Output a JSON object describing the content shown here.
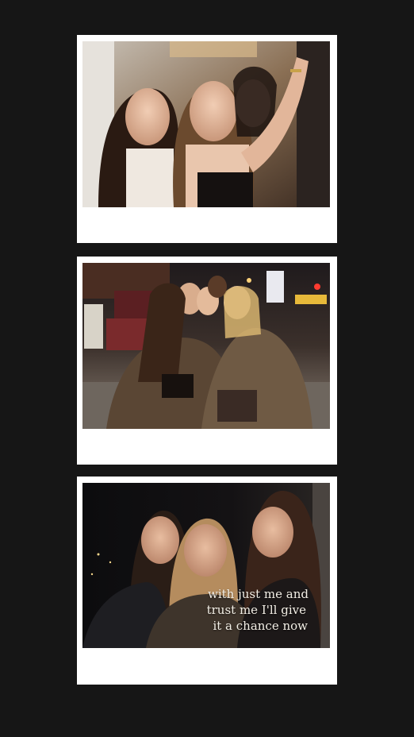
{
  "frames": [
    {
      "name": "photo-selfie-trio"
    },
    {
      "name": "photo-street-hug"
    },
    {
      "name": "photo-night-group"
    }
  ],
  "overlay_text": {
    "line1": "with just me and",
    "line2": "trust me I'll give",
    "line3": "it a chance now"
  },
  "colors": {
    "background": "#161616",
    "frame": "#ffffff",
    "caption_text": "#f3efe6"
  }
}
